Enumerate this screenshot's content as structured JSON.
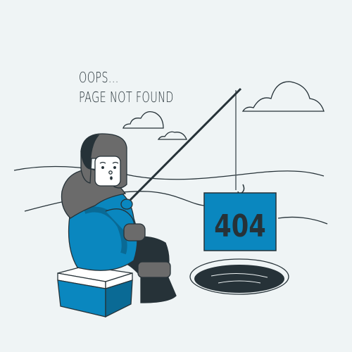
{
  "message": {
    "line1": "OOPS...",
    "line2": "PAGE NOT FOUND"
  },
  "sign": {
    "code": "404"
  },
  "colors": {
    "background": "#eff4f5",
    "accent": "#0a87bf",
    "dark": "#263238",
    "fur": "#6b6b6b"
  }
}
